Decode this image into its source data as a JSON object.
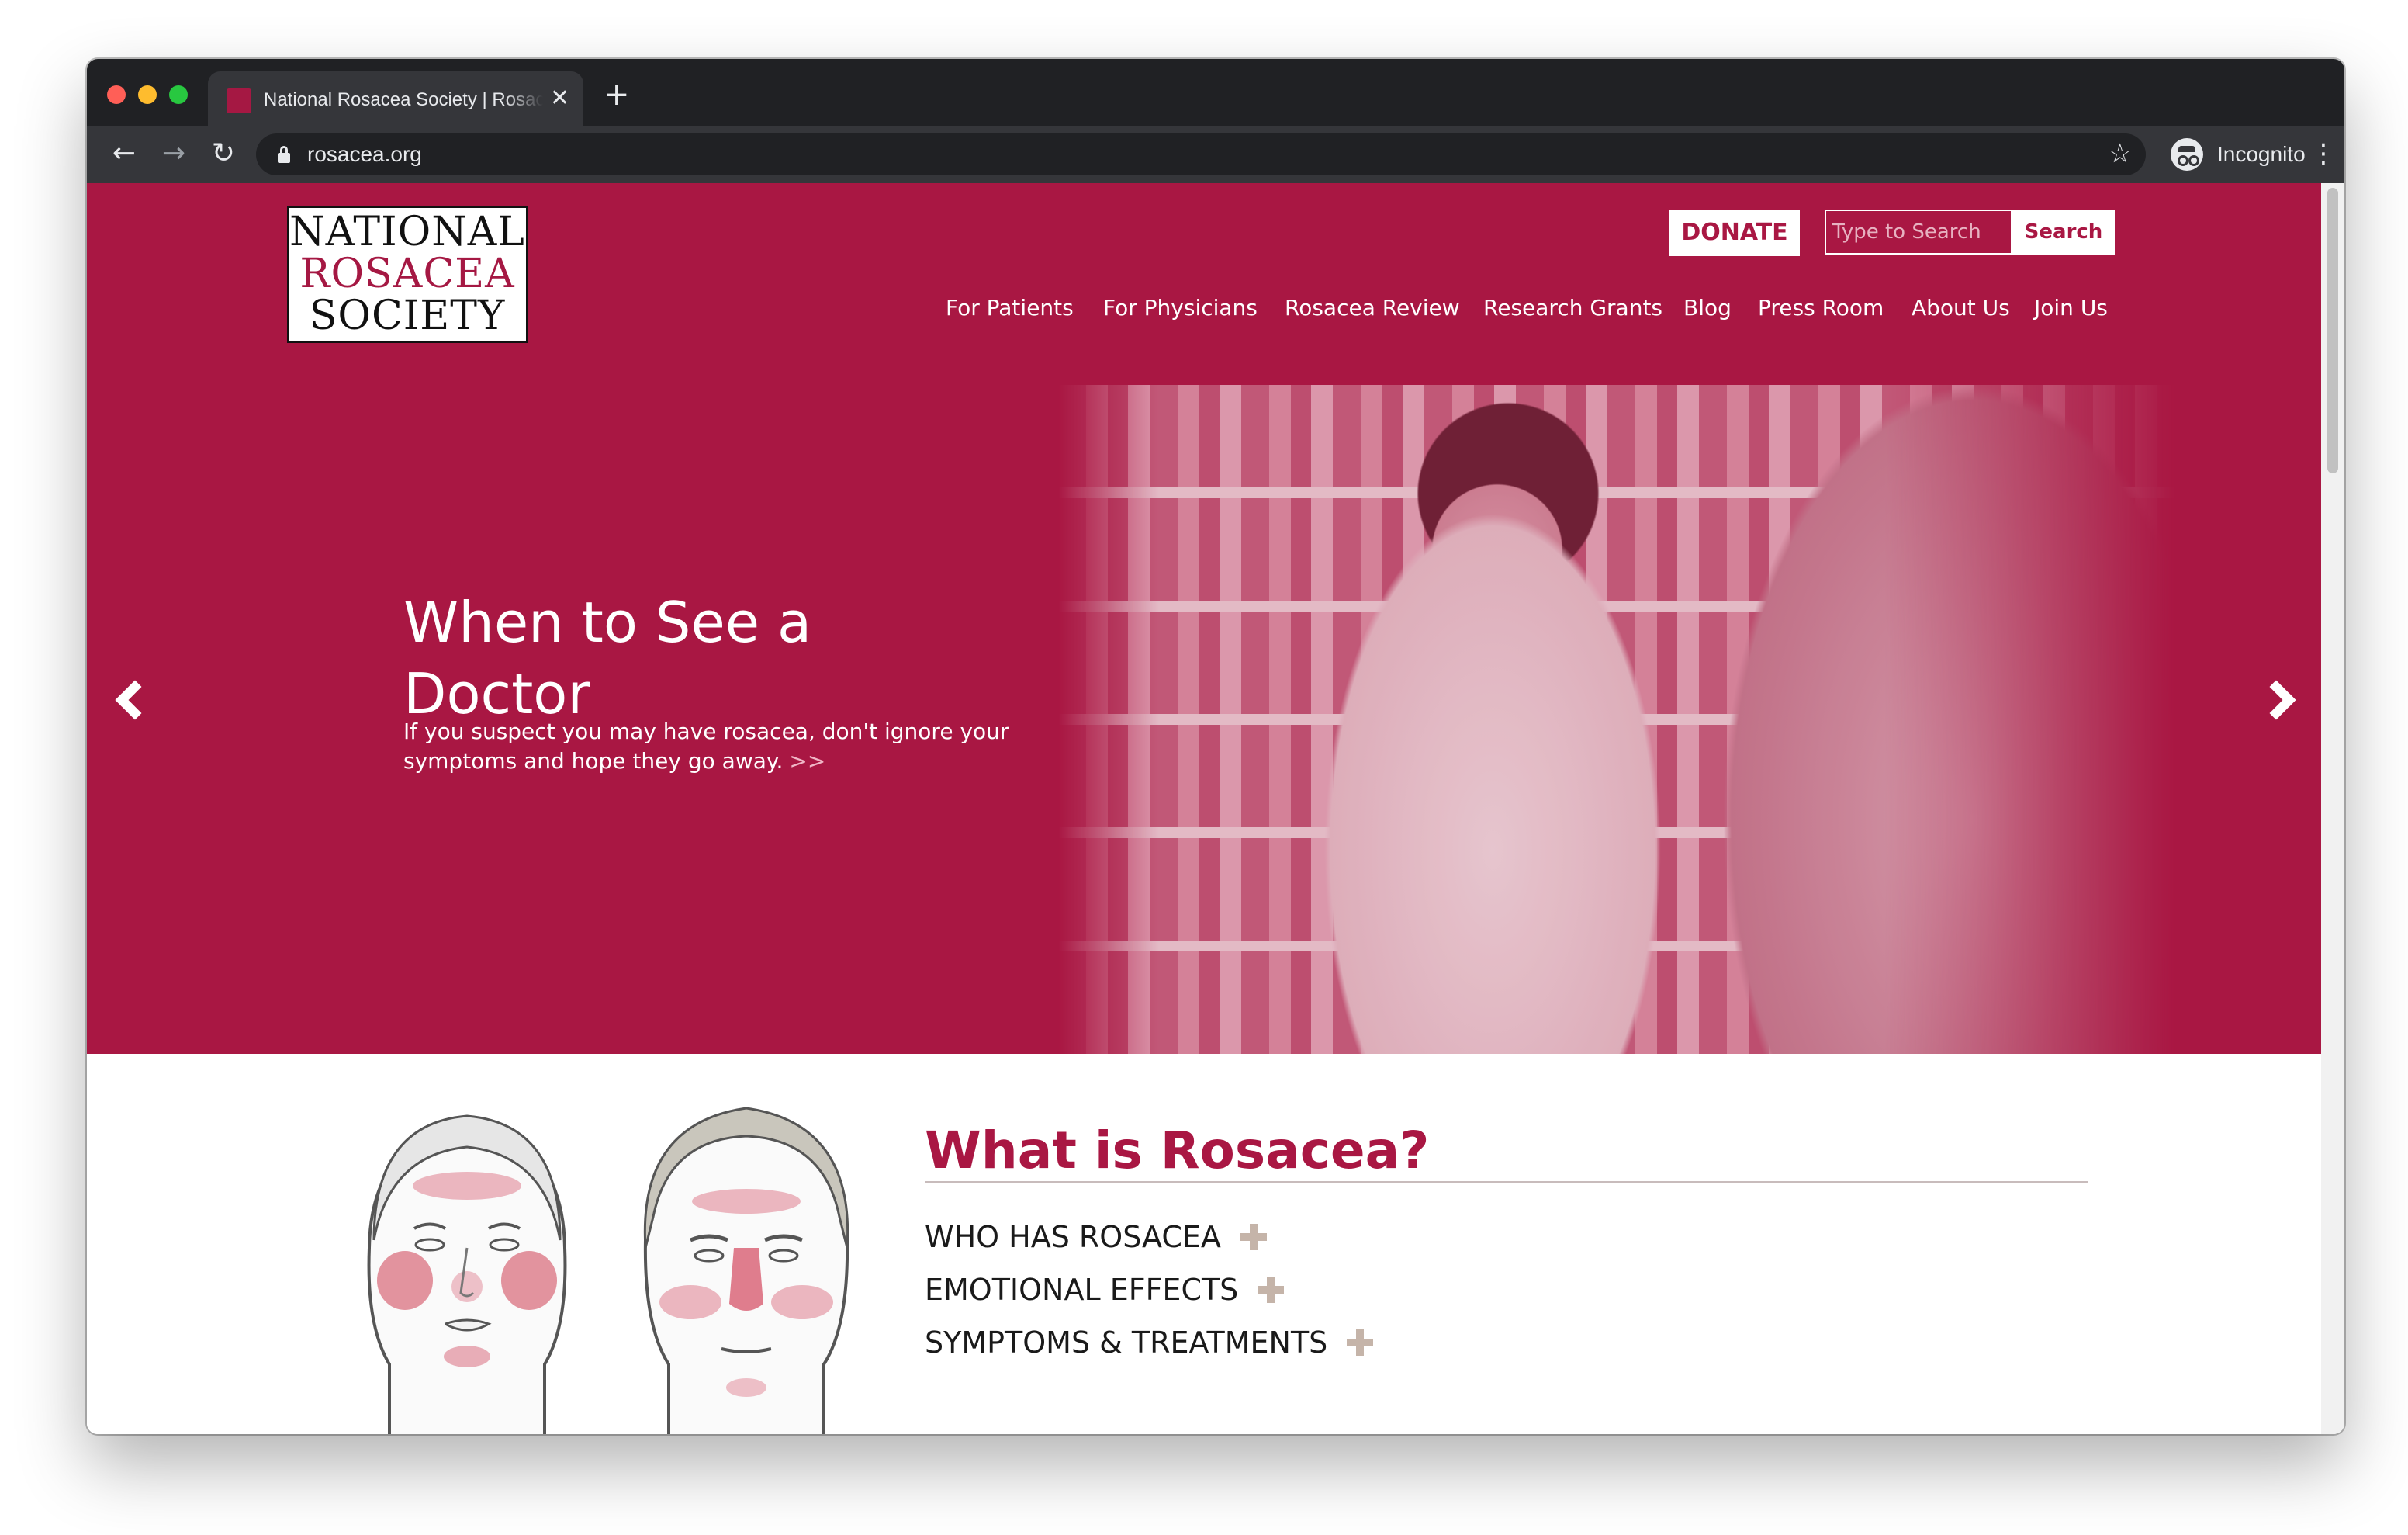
{
  "browser": {
    "tab_title": "National Rosacea Society | Rosacea",
    "tab_close": "✕",
    "new_tab": "+",
    "back": "←",
    "forward": "→",
    "reload": "↻",
    "url": "rosacea.org",
    "bookmark": "☆",
    "profile_label": "Incognito",
    "menu": "⋮"
  },
  "header": {
    "logo_lines": [
      "NATIONAL",
      "ROSACEA",
      "SOCIETY"
    ],
    "donate_label": "DONATE",
    "search_placeholder": "Type to Search",
    "search_button": "Search",
    "nav": [
      "For Patients",
      "For Physicians",
      "Rosacea Review",
      "Research Grants",
      "Blog",
      "Press Room",
      "About Us",
      "Join Us"
    ]
  },
  "hero": {
    "title": "When to See a Doctor",
    "text": "If you suspect you may have rosacea, don't ignore your symptoms and hope they go away.",
    "more_link": ">>"
  },
  "what_is": {
    "title": "What is Rosacea?",
    "items": [
      "WHO HAS ROSACEA",
      "EMOTIONAL EFFECTS",
      "SYMPTOMS & TREATMENTS"
    ]
  },
  "colors": {
    "brand": "#a91743",
    "accordion_plus": "#c5b4a9",
    "chrome_dark": "#202124",
    "chrome_toolbar": "#35363a"
  },
  "icons": {
    "hero_prev": "chevron-left-icon",
    "hero_next": "chevron-right-icon",
    "accordion": "plus-icon",
    "secure": "lock-icon"
  }
}
